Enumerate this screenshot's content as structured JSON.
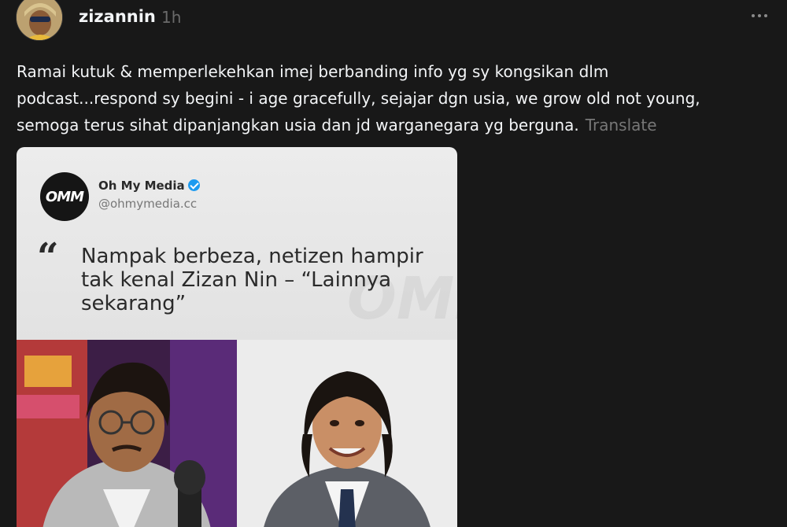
{
  "post": {
    "username": "zizannin",
    "timestamp": "1h",
    "more_icon": "more-horizontal-icon",
    "caption_lines": [
      "Ramai kutuk & memperlekehkan imej berbanding info yg sy kongsikan dlm",
      "podcast...respond sy begini - i age gracefully, sejajar dgn usia, we grow old not young,",
      "semoga terus sihat dipanjangkan usia dan jd warganegara yg berguna."
    ],
    "translate_label": "Translate"
  },
  "media": {
    "source_logo_text": "OMM",
    "source_name": "Oh My Media",
    "source_handle": "@ohmymedia.cc",
    "quote_mark": "“",
    "headline": "Nampak berbeza, netizen hampir tak kenal Zizan Nin – “Lainnya sekarang”"
  },
  "colors": {
    "background": "#181818",
    "text": "#f3f5f7",
    "muted": "#777777",
    "verified": "#1d9bf0"
  }
}
